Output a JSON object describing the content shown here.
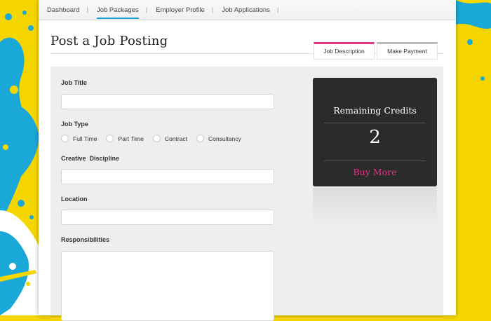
{
  "nav": {
    "items": [
      {
        "label": "Dashboard",
        "active": false
      },
      {
        "label": "Job Packages",
        "active": true
      },
      {
        "label": "Employer Profile",
        "active": false
      },
      {
        "label": "Job Applications",
        "active": false
      }
    ],
    "separator": "|"
  },
  "page": {
    "title": "Post a Job Posting"
  },
  "steps": {
    "job_description": "Job Description",
    "make_payment": "Make Payment"
  },
  "form": {
    "job_title": {
      "label": "Job Title",
      "value": ""
    },
    "job_type": {
      "label": "Job Type",
      "options": [
        "Full Time",
        "Part Time",
        "Contract",
        "Consultancy"
      ]
    },
    "creative_discipline": {
      "label": "Creative  Discipline",
      "value": ""
    },
    "location": {
      "label": "Location",
      "value": ""
    },
    "responsibilities": {
      "label": "Responsibilities",
      "value": ""
    }
  },
  "credits": {
    "title": "Remaining Credits",
    "count": "2",
    "buy_more": "Buy More"
  },
  "colors": {
    "accent_pink": "#e23585",
    "accent_blue": "#1aa6d6",
    "background_yellow": "#f5d600",
    "splash_blue": "#1aa8d8"
  }
}
